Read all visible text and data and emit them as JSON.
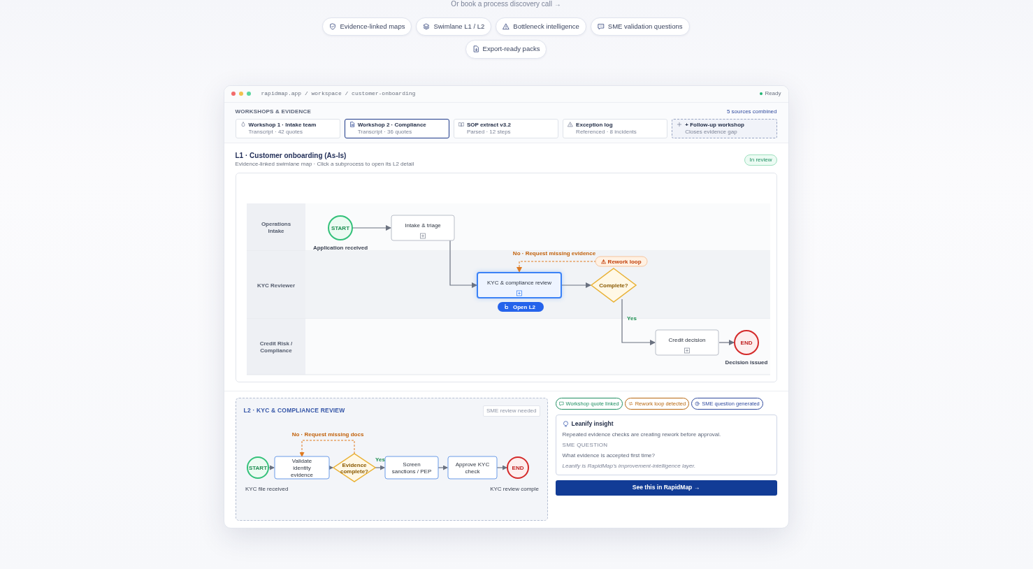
{
  "top_link": "Or book a process discovery call →",
  "features": [
    "Evidence-linked maps",
    "Swimlane L1 / L2",
    "Bottleneck intelligence",
    "SME validation questions",
    "Export-ready packs"
  ],
  "browser": {
    "url": "rapidmap.app / workspace / customer-onboarding",
    "status": "Ready"
  },
  "sources": {
    "heading": "WORKSHOPS & EVIDENCE",
    "summary": "5 sources combined",
    "items": [
      {
        "kind": "source",
        "title": "Workshop 1 · Intake team",
        "subtitle": "Transcript · 42 quotes",
        "selected": false
      },
      {
        "kind": "source",
        "title": "Workshop 2 · Compliance",
        "subtitle": "Transcript · 36 quotes",
        "selected": true
      },
      {
        "kind": "source",
        "title": "SOP extract v3.2",
        "subtitle": "Parsed · 12 steps",
        "selected": false
      },
      {
        "kind": "source",
        "title": "Exception log",
        "subtitle": "Referenced · 8 incidents",
        "selected": false
      },
      {
        "kind": "add",
        "title": "+ Follow-up workshop",
        "subtitle": "Closes evidence gap",
        "selected": false
      }
    ]
  },
  "map": {
    "title": "L1 · Customer onboarding (As-Is)",
    "subtitle": "Evidence-linked swimlane map · Click a subprocess to open its L2 detail",
    "status": "In review",
    "lanes": [
      "Operations Intake",
      "KYC Reviewer",
      "Credit Risk / Compliance"
    ],
    "nodes": [
      {
        "kind": "start",
        "label": "START",
        "caption": "Application received"
      },
      {
        "kind": "task",
        "label": "Intake & triage",
        "selected": false
      },
      {
        "kind": "task",
        "label": "KYC & compliance review",
        "selected": true
      },
      {
        "kind": "decision",
        "label": "Complete?"
      },
      {
        "kind": "task",
        "label": "Credit decision",
        "selected": false
      },
      {
        "kind": "end",
        "label": "END",
        "caption": "Decision issued"
      }
    ],
    "loop_label": "No · Request missing evidence",
    "loop_badge": "⚠ Rework loop",
    "yes_label": "Yes",
    "open_button": "Open L2"
  },
  "l2": {
    "title": "L2 · KYC & COMPLIANCE REVIEW",
    "badge": "SME review needed",
    "nodes": [
      {
        "kind": "start",
        "label": "START",
        "caption": "KYC file received"
      },
      {
        "kind": "task",
        "label": "Validate identity evidence"
      },
      {
        "kind": "decision",
        "label": "Evidence complete?"
      },
      {
        "kind": "task",
        "label": "Screen sanctions / PEP"
      },
      {
        "kind": "task",
        "label": "Approve KYC check"
      },
      {
        "kind": "end",
        "label": "END",
        "caption": "KYC review comple"
      }
    ],
    "loop_label": "No · Request missing docs",
    "yes_label": "Yes"
  },
  "tags": [
    {
      "label": "Workshop quote linked",
      "color": "#1f8f62"
    },
    {
      "label": "Rework loop detected",
      "color": "#b8670f"
    },
    {
      "label": "SME question generated",
      "color": "#2f4a9e"
    }
  ],
  "insight": {
    "title": "Leanify insight",
    "text": "Repeated evidence checks are creating rework before approval.",
    "question_label": "SME QUESTION",
    "question": "What evidence is accepted first time?",
    "note": "Leanify is RapidMap's improvement-intelligence layer."
  },
  "cta": "See this in RapidMap →"
}
